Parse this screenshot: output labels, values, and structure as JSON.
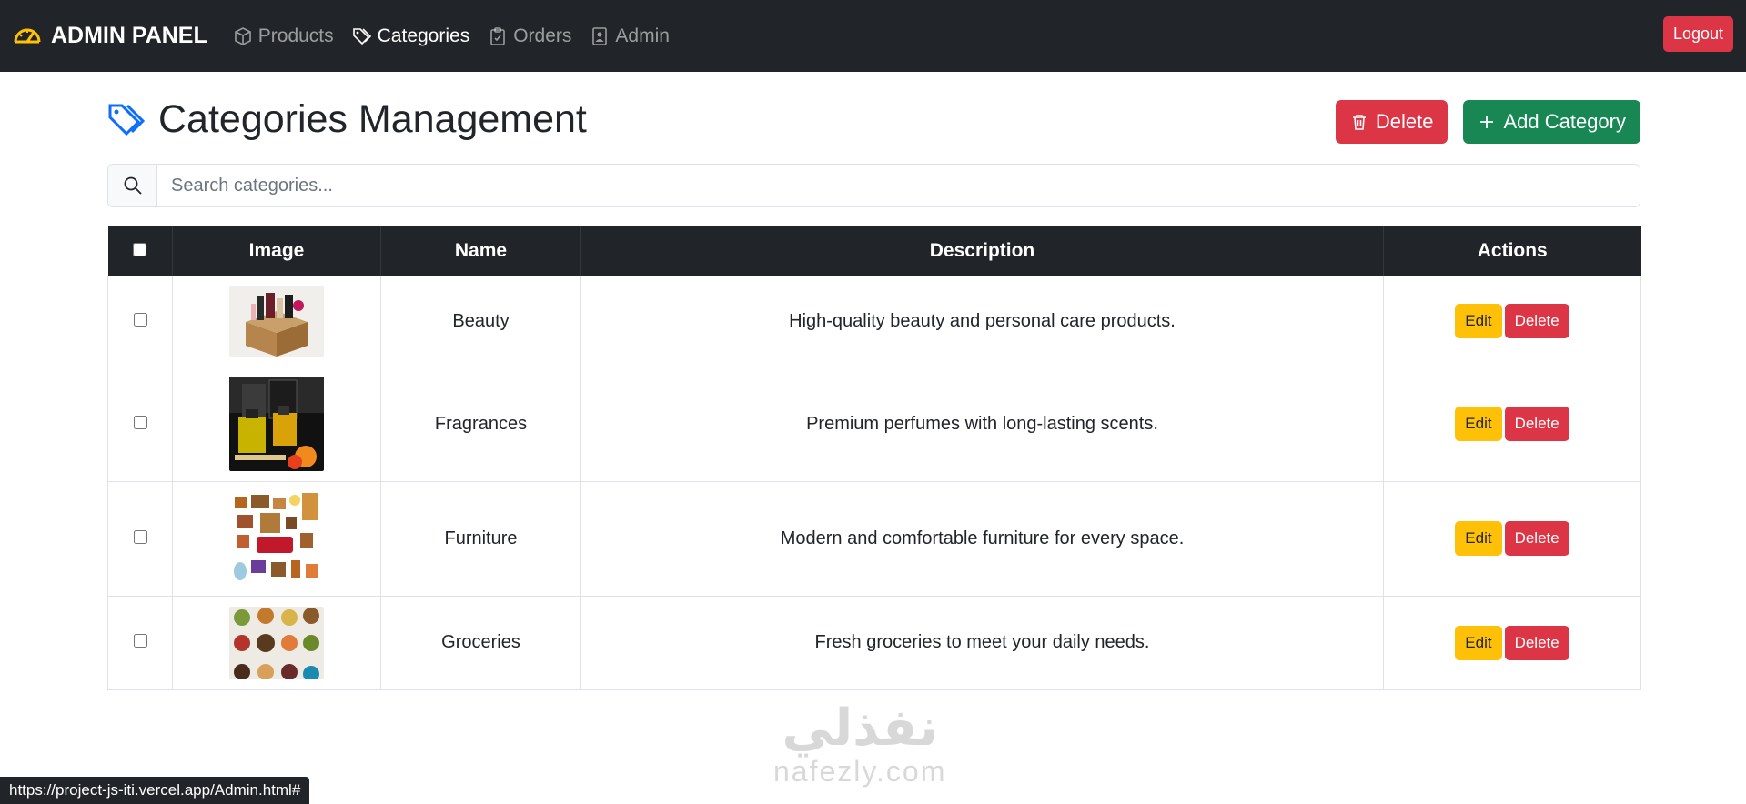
{
  "navbar": {
    "brand": "ADMIN PANEL",
    "links": [
      {
        "label": "Products",
        "icon": "box-icon"
      },
      {
        "label": "Categories",
        "icon": "tags-icon",
        "active": true
      },
      {
        "label": "Orders",
        "icon": "clipboard-check-icon"
      },
      {
        "label": "Admin",
        "icon": "person-badge-icon"
      }
    ],
    "logout_label": "Logout"
  },
  "page": {
    "title": "Categories Management",
    "delete_label": "Delete",
    "add_label": "Add Category"
  },
  "search": {
    "placeholder": "Search categories..."
  },
  "table": {
    "columns": [
      "Image",
      "Name",
      "Description",
      "Actions"
    ],
    "rows": [
      {
        "name": "Beauty",
        "description": "High-quality beauty and personal care products.",
        "image": "beauty-thumbnail"
      },
      {
        "name": "Fragrances",
        "description": "Premium perfumes with long-lasting scents.",
        "image": "fragrances-thumbnail"
      },
      {
        "name": "Furniture",
        "description": "Modern and comfortable furniture for every space.",
        "image": "furniture-thumbnail"
      },
      {
        "name": "Groceries",
        "description": "Fresh groceries to meet your daily needs.",
        "image": "groceries-thumbnail"
      }
    ],
    "edit_label": "Edit",
    "delete_label": "Delete"
  },
  "watermark": {
    "arabic": "نفذلي",
    "latin": "nafezly.com"
  },
  "statusbar": {
    "url": "https://project-js-iti.vercel.app/Admin.html#"
  },
  "colors": {
    "navbar": "#212529",
    "danger": "#dc3545",
    "success": "#198754",
    "warning": "#ffc107",
    "brand_icon": "#ffc107",
    "title_icon": "#0d6efd"
  }
}
